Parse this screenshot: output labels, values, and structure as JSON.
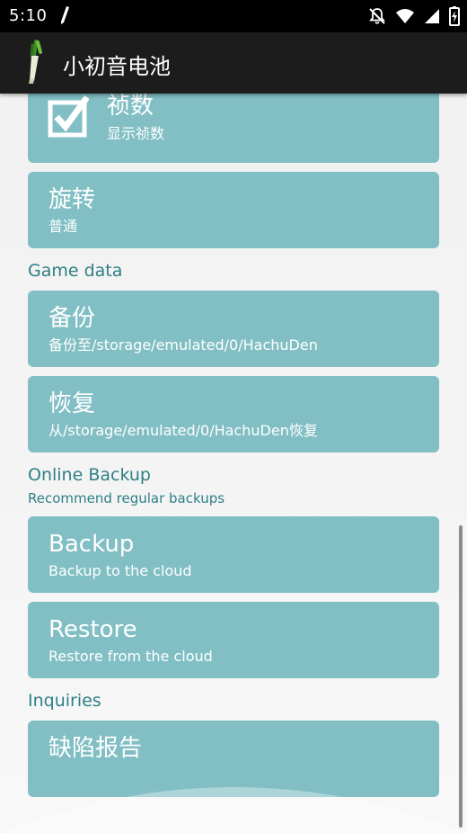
{
  "status_bar": {
    "time": "5:10",
    "icons": [
      "pen-icon",
      "notifications-off-icon",
      "wifi-icon",
      "cell-signal-icon",
      "battery-charging-icon"
    ]
  },
  "app_bar": {
    "title": "小初音电池",
    "logo_icon": "leek-icon"
  },
  "preferences": {
    "frames": {
      "title": "祯数",
      "summary": "显示祯数",
      "checked": true
    },
    "rotation": {
      "title": "旋转",
      "summary": "普通"
    }
  },
  "game_data": {
    "header": "Game data",
    "backup": {
      "title": "备份",
      "summary": "备份至/storage/emulated/0/HachuDen"
    },
    "restore": {
      "title": "恢复",
      "summary": "从/storage/emulated/0/HachuDen恢复"
    }
  },
  "online_backup": {
    "header": "Online Backup",
    "subtitle": "Recommend regular backups",
    "backup": {
      "title": "Backup",
      "summary": "Backup to the cloud"
    },
    "restore": {
      "title": "Restore",
      "summary": "Restore from the cloud"
    }
  },
  "inquiries": {
    "header": "Inquiries",
    "bug_report": {
      "title": "缺陷报告"
    }
  },
  "colors": {
    "card": "#81bfc4",
    "accent_text": "#2e7f86",
    "app_bar": "#1c1c1c",
    "status_bar": "#000000"
  }
}
